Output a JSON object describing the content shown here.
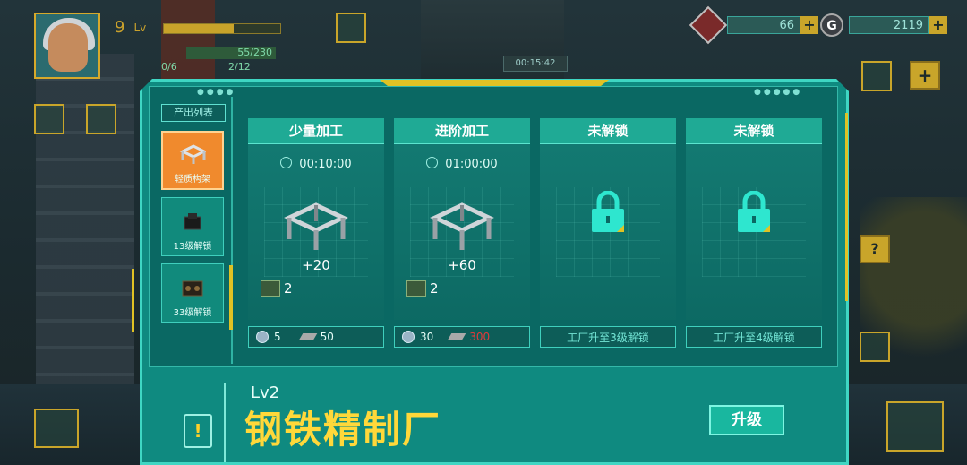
{
  "hud": {
    "player_level": "9",
    "level_label": "Lv",
    "stat_a": "55/230",
    "stat_b": "0/6",
    "stat_c": "2/12",
    "timer": "00:15:42",
    "gems": "66",
    "gold": "2119",
    "gold_letter": "G",
    "plus": "+"
  },
  "sidebar": {
    "header": "产出列表",
    "items": [
      {
        "label": "轻质构架",
        "selected": true
      },
      {
        "label": "13级解锁",
        "selected": false
      },
      {
        "label": "33级解锁",
        "selected": false
      }
    ]
  },
  "cards": [
    {
      "title": "少量加工",
      "time": "00:10:00",
      "yield": "+20",
      "units": "2",
      "cost_ore": "5",
      "cost_steel": "50",
      "locked": false
    },
    {
      "title": "进阶加工",
      "time": "01:00:00",
      "yield": "+60",
      "units": "2",
      "cost_ore": "30",
      "cost_steel": "300",
      "locked": false
    },
    {
      "title": "未解锁",
      "unlock_text": "工厂升至3级解锁",
      "locked": true
    },
    {
      "title": "未解锁",
      "unlock_text": "工厂升至4级解锁",
      "locked": true
    }
  ],
  "building": {
    "level": "Lv2",
    "name": "钢铁精制厂",
    "upgrade_label": "升级",
    "alert_symbol": "!"
  },
  "colors": {
    "panel": "#0f8a80",
    "accent_yellow": "#e0c224",
    "selected_orange": "#f08a2d",
    "insufficient_red": "#e23a3a"
  }
}
